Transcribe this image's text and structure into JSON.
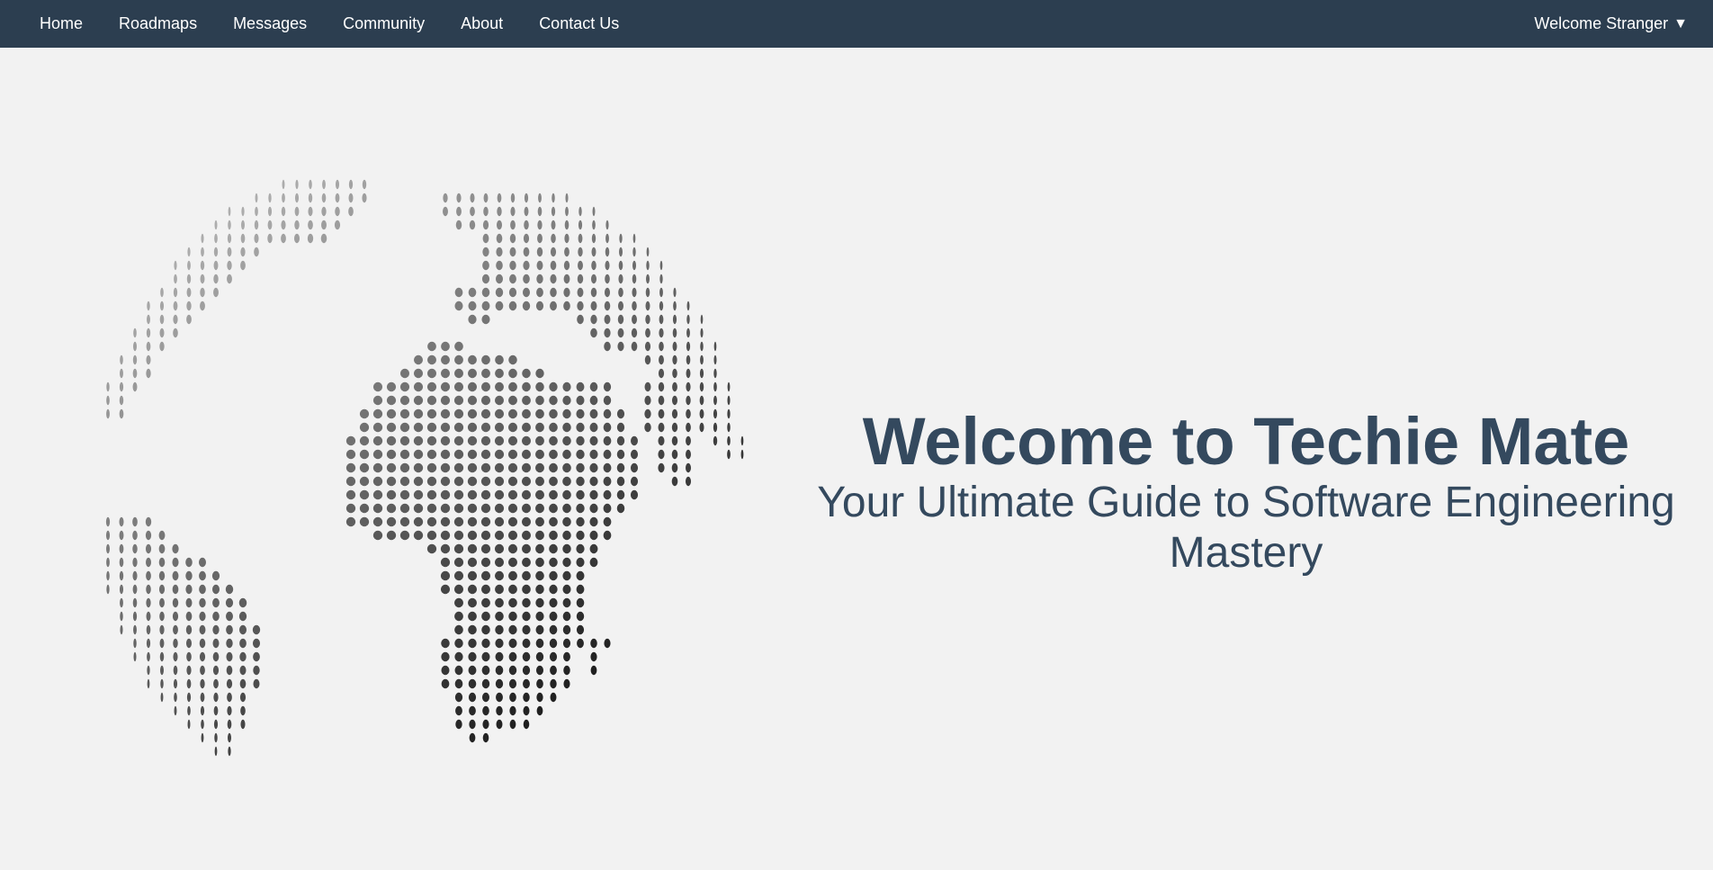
{
  "navbar": {
    "links": [
      {
        "label": "Home"
      },
      {
        "label": "Roadmaps"
      },
      {
        "label": "Messages"
      },
      {
        "label": "Community"
      },
      {
        "label": "About"
      },
      {
        "label": "Contact Us"
      }
    ],
    "user_menu": {
      "label": "Welcome Stranger",
      "caret": "▼"
    }
  },
  "hero": {
    "title": "Welcome to Techie Mate",
    "subtitle": "Your Ultimate Guide to Software Engineering Mastery",
    "image_icon": "dotted-globe-icon"
  },
  "colors": {
    "navbar_bg": "#2c3e50",
    "page_bg": "#f2f2f2",
    "heading": "#34495e"
  }
}
